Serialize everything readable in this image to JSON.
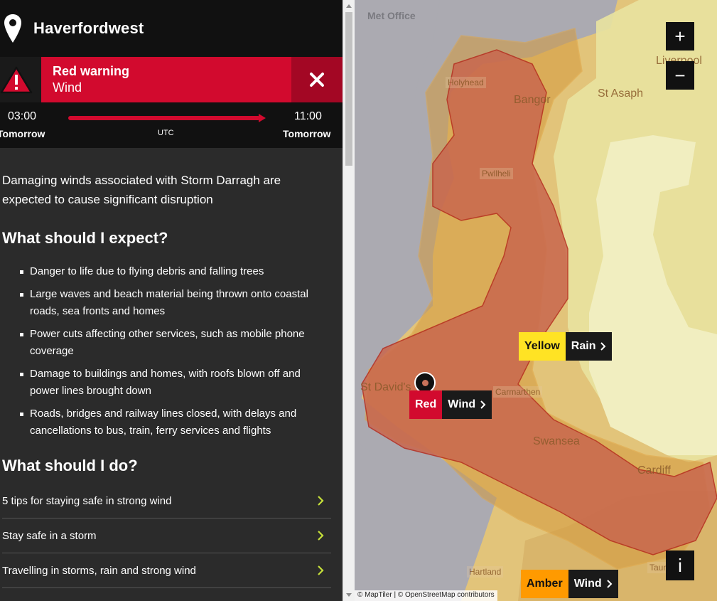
{
  "header": {
    "location": "Haverfordwest",
    "icon": "map-pin-icon"
  },
  "warning": {
    "level": "Red warning",
    "type": "Wind",
    "icon": "warning-triangle-icon",
    "close_icon": "close-icon",
    "color": "#d20a2e"
  },
  "timebar": {
    "start_time": "03:00",
    "start_day": "Tomorrow",
    "end_time": "11:00",
    "end_day": "Tomorrow",
    "timezone": "UTC"
  },
  "summary": "Damaging winds associated with Storm Darragh are expected to cause significant disruption",
  "expect": {
    "title": "What should I expect?",
    "items": [
      "Danger to life due to flying debris and falling trees",
      "Large waves and beach material being thrown onto coastal roads, sea fronts and homes",
      "Power cuts affecting other services, such as mobile phone coverage",
      "Damage to buildings and homes, with roofs blown off and power lines brought down",
      "Roads, bridges and railway lines closed, with delays and cancellations to bus, train, ferry services and flights"
    ]
  },
  "do": {
    "title": "What should I do?",
    "links": [
      "5 tips for staying safe in strong wind",
      "Stay safe in a storm",
      "Travelling in storms, rain and strong wind"
    ],
    "chevron_color": "#c6e03a"
  },
  "map": {
    "logo": "Met Office",
    "zoom_in": "+",
    "zoom_out": "−",
    "info": "i",
    "attribution": "© MapTiler | © OpenStreetMap contributors",
    "places": [
      "Liverpool",
      "Holyhead",
      "Bangor",
      "St Asaph",
      "Pwllheli",
      "St David's",
      "Carmarthen",
      "Swansea",
      "Cardiff",
      "Hartland",
      "Taun"
    ],
    "tags": [
      {
        "level": "Red",
        "type": "Wind",
        "color": "#d20a2e"
      },
      {
        "level": "Yellow",
        "type": "Rain",
        "color": "#ffe324"
      },
      {
        "level": "Amber",
        "type": "Wind",
        "color": "#ff9a00"
      }
    ]
  }
}
